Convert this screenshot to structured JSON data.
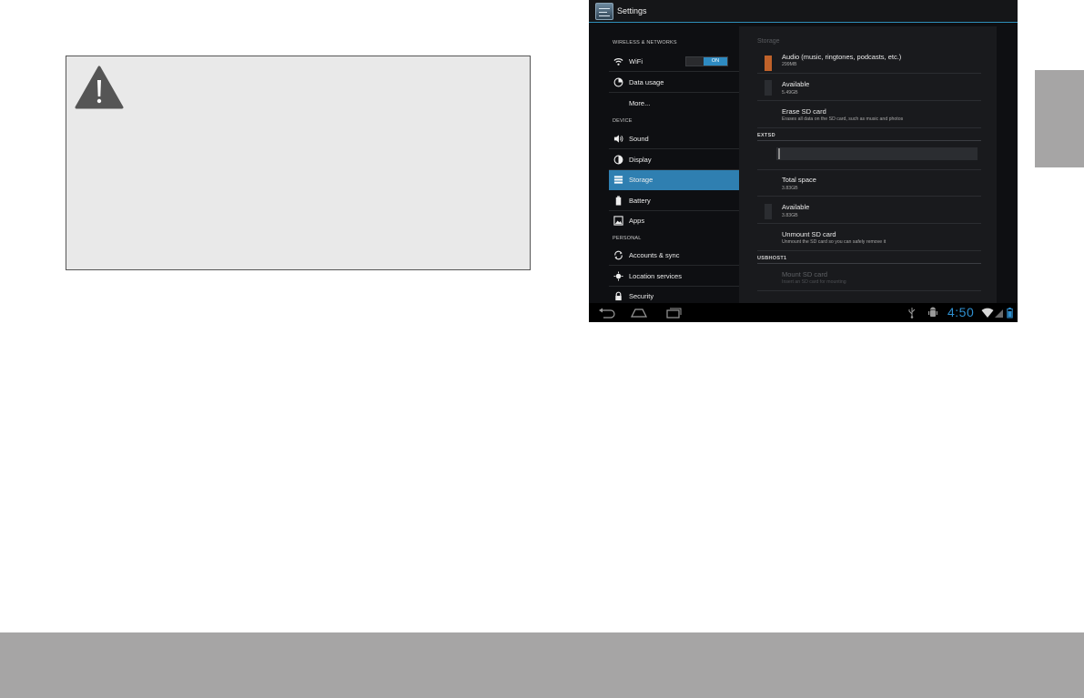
{
  "screenshot": {
    "action_bar": {
      "title": "Settings",
      "icon": "settings-app-icon"
    },
    "sidebar": {
      "sections": [
        {
          "header": "WIRELESS & NETWORKS"
        },
        {
          "header": "DEVICE"
        },
        {
          "header": "PERSONAL"
        }
      ],
      "items": [
        {
          "label": "WiFi",
          "icon": "wifi-icon",
          "toggle": "ON"
        },
        {
          "label": "Data usage",
          "icon": "data-usage-icon"
        },
        {
          "label": "More...",
          "icon": ""
        },
        {
          "label": "Sound",
          "icon": "speaker-icon"
        },
        {
          "label": "Display",
          "icon": "display-icon"
        },
        {
          "label": "Storage",
          "icon": "storage-icon",
          "selected": true
        },
        {
          "label": "Battery",
          "icon": "battery-icon"
        },
        {
          "label": "Apps",
          "icon": "apps-icon"
        },
        {
          "label": "Accounts & sync",
          "icon": "sync-icon"
        },
        {
          "label": "Location services",
          "icon": "location-icon"
        },
        {
          "label": "Security",
          "icon": "lock-icon"
        }
      ]
    },
    "storage": {
      "title": "Storage",
      "rows": [
        {
          "title": "Audio (music, ringtones, podcasts, etc.)",
          "sub": "299MB",
          "color": "#c0622a"
        },
        {
          "title": "Available",
          "sub": "5.49GB",
          "color": "#2b2d31"
        },
        {
          "title": "Erase SD card",
          "sub": "Erases all data on the SD card, such as music and photos"
        }
      ],
      "extsd_header": "EXTSD",
      "extsd_usage_fraction": 0.01,
      "extsd_rows": [
        {
          "title": "Total space",
          "sub": "3.83GB"
        },
        {
          "title": "Available",
          "sub": "3.83GB",
          "color": "#2b2d31"
        },
        {
          "title": "Unmount SD card",
          "sub": "Unmount the SD card so you can safely remove it"
        }
      ],
      "usbhost_header": "USBHOST1",
      "usbhost_rows": [
        {
          "title": "Mount SD card",
          "sub": "Insert an SD card for mounting"
        }
      ]
    },
    "status_bar": {
      "time": "4:50"
    }
  },
  "colors": {
    "accent": "#2f7fb1",
    "page_band": "#a6a5a5",
    "warning_box": "#e9e9e9"
  }
}
